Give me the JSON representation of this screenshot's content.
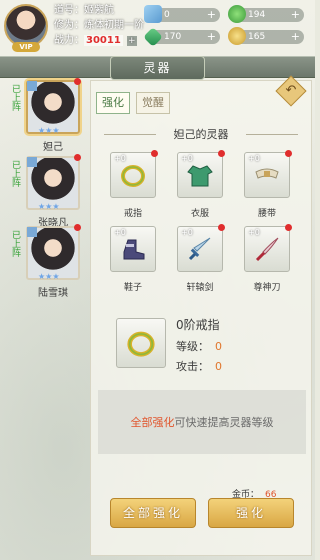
{
  "player": {
    "daohao": "道号：姬紫航",
    "xiuwei": "修为：炼体初期一阶",
    "zhanli_label": "战力：",
    "zhanli_value": "30011",
    "vip": "VIP",
    "plus": "+"
  },
  "resources": [
    {
      "value": "0",
      "icon": "diamond-icon"
    },
    {
      "value": "194",
      "icon": "jade-icon"
    },
    {
      "value": "170",
      "icon": "emerald-icon"
    },
    {
      "value": "165",
      "icon": "coin-icon"
    }
  ],
  "resource_add": "+",
  "header": {
    "title": "灵器"
  },
  "characters": [
    {
      "status": "已上阵",
      "name": "妲己",
      "stars": "★★★",
      "selected": true
    },
    {
      "status": "已上阵",
      "name": "张晓凡",
      "stars": "★★★",
      "selected": false
    },
    {
      "status": "已上阵",
      "name": "陆雪琪",
      "stars": "★★★",
      "selected": false
    }
  ],
  "tabs": [
    "强化",
    "觉醒"
  ],
  "section_title": "妲己的灵器",
  "equipment": [
    {
      "label": "戒指",
      "level": "+0",
      "icon": "ring-icon"
    },
    {
      "label": "衣服",
      "level": "+0",
      "icon": "robe-icon"
    },
    {
      "label": "腰带",
      "level": "+0",
      "icon": "belt-icon"
    },
    {
      "label": "鞋子",
      "level": "+0",
      "icon": "boot-icon"
    },
    {
      "label": "轩辕剑",
      "level": "+0",
      "icon": "sword-icon"
    },
    {
      "label": "尊神刀",
      "level": "+0",
      "icon": "blade-icon"
    }
  ],
  "detail": {
    "name": "0阶戒指",
    "level_label": "等级：",
    "level_value": "0",
    "attack_label": "攻击：",
    "attack_value": "0"
  },
  "hint": {
    "highlight": "全部强化",
    "rest": "可快速提高灵器等级"
  },
  "gold": {
    "label": "金币：",
    "value": "66"
  },
  "buttons": {
    "all": "全部强化",
    "single": "强化"
  },
  "back": "↶",
  "colors": {
    "accent": "#d9a744",
    "highlight": "#e0552d",
    "status_green": "#39a33a"
  }
}
